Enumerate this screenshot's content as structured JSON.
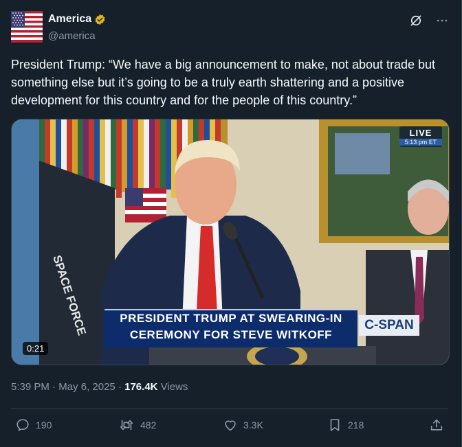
{
  "author": {
    "display_name": "America",
    "handle": "@america",
    "avatar_icon": "us-flag-icon",
    "verified_icon": "verified-gold-badge-icon",
    "verified_color": "#e2b719"
  },
  "header_icons": [
    "grok-icon",
    "more-icon"
  ],
  "tweet": {
    "text": "President Trump: “We have a big announcement to make, not about trade but something else but it’s going to be a truly earth shattering and a positive development for this country and for the people of this country.”"
  },
  "media": {
    "live_label": "LIVE",
    "live_time": "5:13 pm ET",
    "chyron_line1": "PRESIDENT TRUMP AT SWEARING-IN",
    "chyron_line2": "CEREMONY FOR STEVE WITKOFF",
    "network": "C-SPAN",
    "flag_text": "SPACE FORCE",
    "duration": "0:21"
  },
  "meta": {
    "time": "5:39 PM",
    "separator": "·",
    "date": "May 6, 2025",
    "views_count": "176.4K",
    "views_label": "Views"
  },
  "actions": {
    "replies": "190",
    "reposts": "482",
    "likes": "3.3K",
    "bookmarks": "218"
  },
  "colors": {
    "background": "#15202b",
    "text": "#f7f9f9",
    "secondary_text": "#8b98a5",
    "border": "#38444d"
  }
}
